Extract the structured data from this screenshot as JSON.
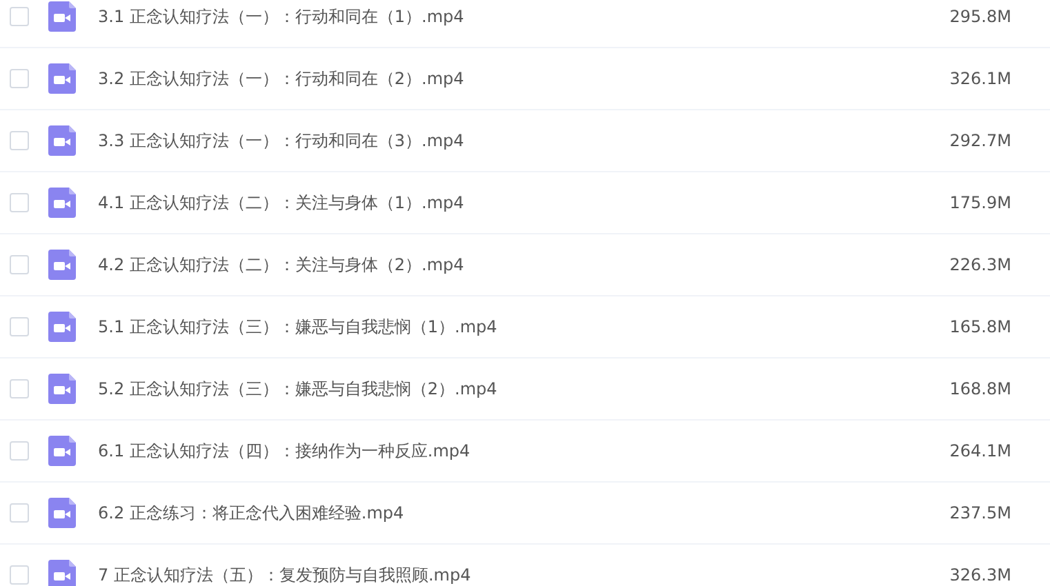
{
  "files": [
    {
      "name": "3.1 正念认知疗法（一）：行动和同在（1）.mp4",
      "size": "295.8M",
      "checked": false
    },
    {
      "name": "3.2 正念认知疗法（一）：行动和同在（2）.mp4",
      "size": "326.1M",
      "checked": false
    },
    {
      "name": "3.3 正念认知疗法（一）：行动和同在（3）.mp4",
      "size": "292.7M",
      "checked": false
    },
    {
      "name": "4.1 正念认知疗法（二）：关注与身体（1）.mp4",
      "size": "175.9M",
      "checked": false
    },
    {
      "name": "4.2 正念认知疗法（二）：关注与身体（2）.mp4",
      "size": "226.3M",
      "checked": false
    },
    {
      "name": "5.1 正念认知疗法（三）：嫌恶与自我悲悯（1）.mp4",
      "size": "165.8M",
      "checked": false
    },
    {
      "name": "5.2 正念认知疗法（三）：嫌恶与自我悲悯（2）.mp4",
      "size": "168.8M",
      "checked": false
    },
    {
      "name": "6.1 正念认知疗法（四）：接纳作为一种反应.mp4",
      "size": "264.1M",
      "checked": false
    },
    {
      "name": "6.2 正念练习：将正念代入困难经验.mp4",
      "size": "237.5M",
      "checked": false
    },
    {
      "name": "7 正念认知疗法（五）：复发预防与自我照顾.mp4",
      "size": "326.3M",
      "checked": false
    }
  ]
}
